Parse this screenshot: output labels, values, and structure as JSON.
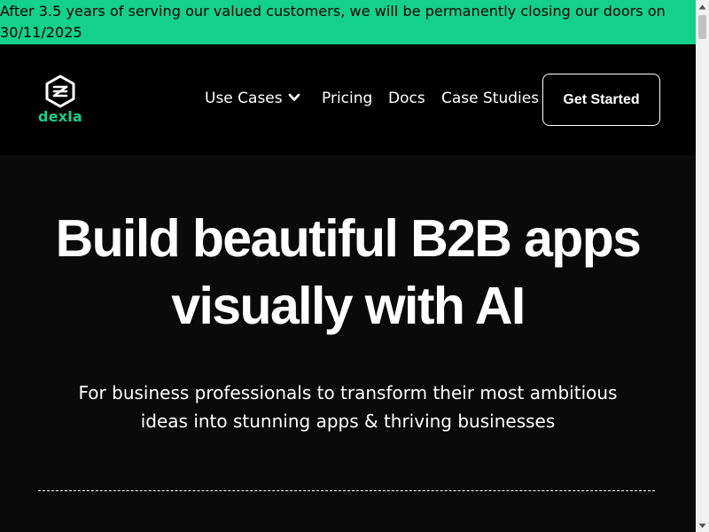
{
  "banner": {
    "text": "After 3.5 years of serving our valued customers, we will be permanently closing our doors on 30/11/2025"
  },
  "header": {
    "logo_text": "dexla",
    "nav": {
      "use_cases": "Use Cases",
      "pricing": "Pricing",
      "docs": "Docs",
      "case_studies": "Case Studies"
    },
    "cta_label": "Get Started"
  },
  "hero": {
    "title": "Build beautiful B2B apps visually with AI",
    "subtitle": "For business professionals to transform their most ambitious ideas into stunning apps & thriving businesses"
  },
  "colors": {
    "banner_bg": "#13d08c",
    "brand": "#13d08c",
    "page_bg": "#0a0a0a",
    "text": "#ffffff"
  },
  "icons": {
    "logo": "dexla-hexagon-logo-icon",
    "dropdown": "chevron-down-icon",
    "scroll_up": "scroll-up-arrow-icon",
    "scroll_down": "scroll-down-arrow-icon"
  }
}
